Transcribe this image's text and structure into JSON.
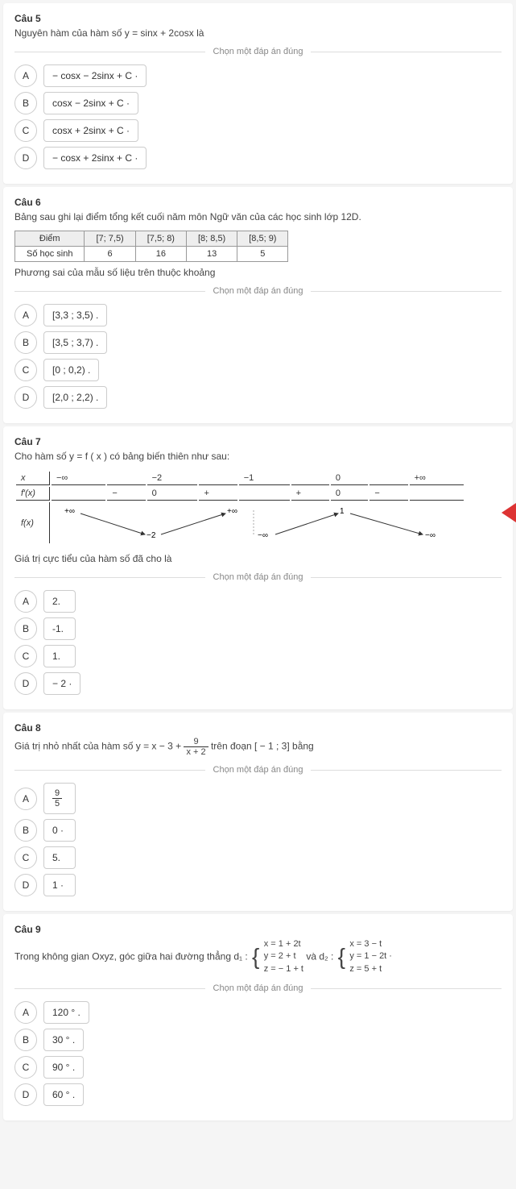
{
  "instruction": "Chọn một đáp án đúng",
  "q5": {
    "title": "Câu 5",
    "stem": "Nguyên hàm của hàm số y = sinx + 2cosx là",
    "opts": {
      "A": "− cosx − 2sinx + C ·",
      "B": "cosx − 2sinx + C ·",
      "C": "cosx + 2sinx + C ·",
      "D": "− cosx + 2sinx + C ·"
    }
  },
  "q6": {
    "title": "Câu 6",
    "stem": "Bảng sau ghi lại điểm tổng kết cuối năm môn Ngữ văn của các học sinh lớp 12D.",
    "table": {
      "h0": "Điểm",
      "h1": "[7; 7,5)",
      "h2": "[7,5; 8)",
      "h3": "[8; 8,5)",
      "h4": "[8,5; 9)",
      "r0": "Số học sinh",
      "r1": "6",
      "r2": "16",
      "r3": "13",
      "r4": "5"
    },
    "sub": "Phương sai của mẫu số liệu trên thuộc khoảng",
    "opts": {
      "A": "[3,3 ; 3,5) .",
      "B": "[3,5 ; 3,7) .",
      "C": "[0 ; 0,2) .",
      "D": "[2,0 ; 2,2) ."
    }
  },
  "q7": {
    "title": "Câu 7",
    "stem": "Cho hàm số y = f ( x ) có bảng biến thiên như sau:",
    "chart_data": {
      "type": "table",
      "rows": [
        {
          "label": "x",
          "cells": [
            "−∞",
            "",
            "−2",
            "",
            "−1",
            "",
            "0",
            "",
            "+∞"
          ]
        },
        {
          "label": "f′(x)",
          "cells": [
            "",
            "−",
            "0",
            "+",
            "",
            "+",
            "0",
            "−",
            ""
          ]
        },
        {
          "label": "f(x)",
          "cells": [
            "+∞",
            "↘",
            "−2",
            "↗",
            "+∞ / −∞",
            "↗",
            "1",
            "↘",
            "−∞"
          ]
        }
      ]
    },
    "sub": "Giá trị cực tiểu của hàm số đã cho là",
    "opts": {
      "A": "2.",
      "B": "-1.",
      "C": "1.",
      "D": "− 2 ·"
    }
  },
  "q8": {
    "title": "Câu 8",
    "stem_pre": "Giá trị nhỏ nhất của hàm số y = x − 3 + ",
    "frac_num": "9",
    "frac_den": "x + 2",
    "stem_post": " trên đoạn [ − 1 ; 3] bằng",
    "opts": {
      "A_num": "9",
      "A_den": "5",
      "B": "0 ·",
      "C": "5.",
      "D": "1 ·"
    }
  },
  "q9": {
    "title": "Câu 9",
    "stem_pre": "Trong không gian Oxyz, góc giữa hai đường thẳng d₁ : ",
    "d1": {
      "l1": "x = 1 + 2t",
      "l2": "y = 2 + t",
      "l3": "z = − 1 + t"
    },
    "mid": " và d₂ : ",
    "d2": {
      "l1": "x = 3 − t",
      "l2": "y = 1 − 2t ·",
      "l3": "z = 5 + t"
    },
    "opts": {
      "A": "120 ° .",
      "B": "30 ° .",
      "C": "90 ° .",
      "D": "60 ° ."
    }
  }
}
